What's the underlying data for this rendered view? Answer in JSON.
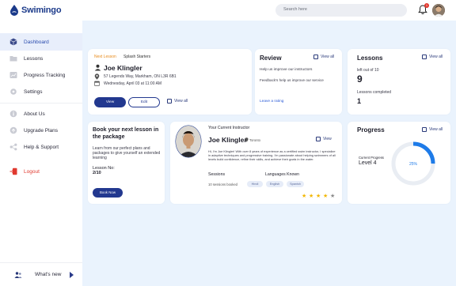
{
  "app": {
    "name": "Swimingo"
  },
  "topbar": {
    "search_placeholder": "Search here",
    "notification_count": "1"
  },
  "sidebar": {
    "items": [
      {
        "label": "Dashboard",
        "icon": "cube-icon"
      },
      {
        "label": "Lessons",
        "icon": "folder-icon"
      },
      {
        "label": "Progress Tracking",
        "icon": "chart-icon"
      },
      {
        "label": "Settings",
        "icon": "gear-icon"
      },
      {
        "label": "About Us",
        "icon": "info-icon"
      },
      {
        "label": "Upgrade Plans",
        "icon": "upgrade-icon"
      },
      {
        "label": "Help & Support",
        "icon": "share-icon"
      },
      {
        "label": "Logout",
        "icon": "logout-icon"
      }
    ],
    "whats_new": "What's new"
  },
  "next_lesson": {
    "tab_active": "Next Lesson",
    "tab_other": "Splash Starters",
    "instructor": "Joe Klingler",
    "address": "57 Legends Way, Markham, ON L3R 6B1",
    "datetime": "Wednesday, April 03 at 11:00 AM",
    "view_label": "View",
    "edit_label": "Edit",
    "view_all": "View all"
  },
  "review": {
    "title": "Review",
    "view_all": "View all",
    "prompt": "Help us improve our instructors",
    "body": "Feedback's help us improve our service",
    "link": "Leave a rating"
  },
  "lessons": {
    "title": "Lessons",
    "view_all": "View all",
    "left_label": "left out of 10",
    "left_value": "9",
    "completed_label": "Lessons completed",
    "completed_value": "1"
  },
  "book": {
    "title": "Book your next lesson in the package",
    "body": "Learn from our perfect plans and packages to give yourself an extended learning",
    "lesson_no_label": "Lesson No:",
    "lesson_no_value": "2/10",
    "button": "Book Now"
  },
  "instructor": {
    "heading": "Your Current Instructor",
    "name": "Joe Klingler",
    "location": "Toronto",
    "view": "View",
    "bio": "Hi, I'm Joe Klingler! With over 8 years of experience as a certified swim instructor, I specialize in adaptive techniques and progressive training. I'm passionate about helping swimmers of all levels build confidence, refine their skills, and achieve their goals in the water.",
    "sessions_label": "Sessions",
    "sessions_value": "10 sessions booked",
    "languages_label": "Languages Known",
    "languages": [
      "Hindi",
      "English",
      "Spanish"
    ],
    "rating": 4,
    "rating_max": 5
  },
  "progress": {
    "title": "Progress",
    "view_all": "View all",
    "current_label": "Current Progress",
    "level": "Level 4",
    "percent_text": "25%",
    "percent": 25,
    "accent": "#1e7be8",
    "track": "#e9edf3"
  }
}
